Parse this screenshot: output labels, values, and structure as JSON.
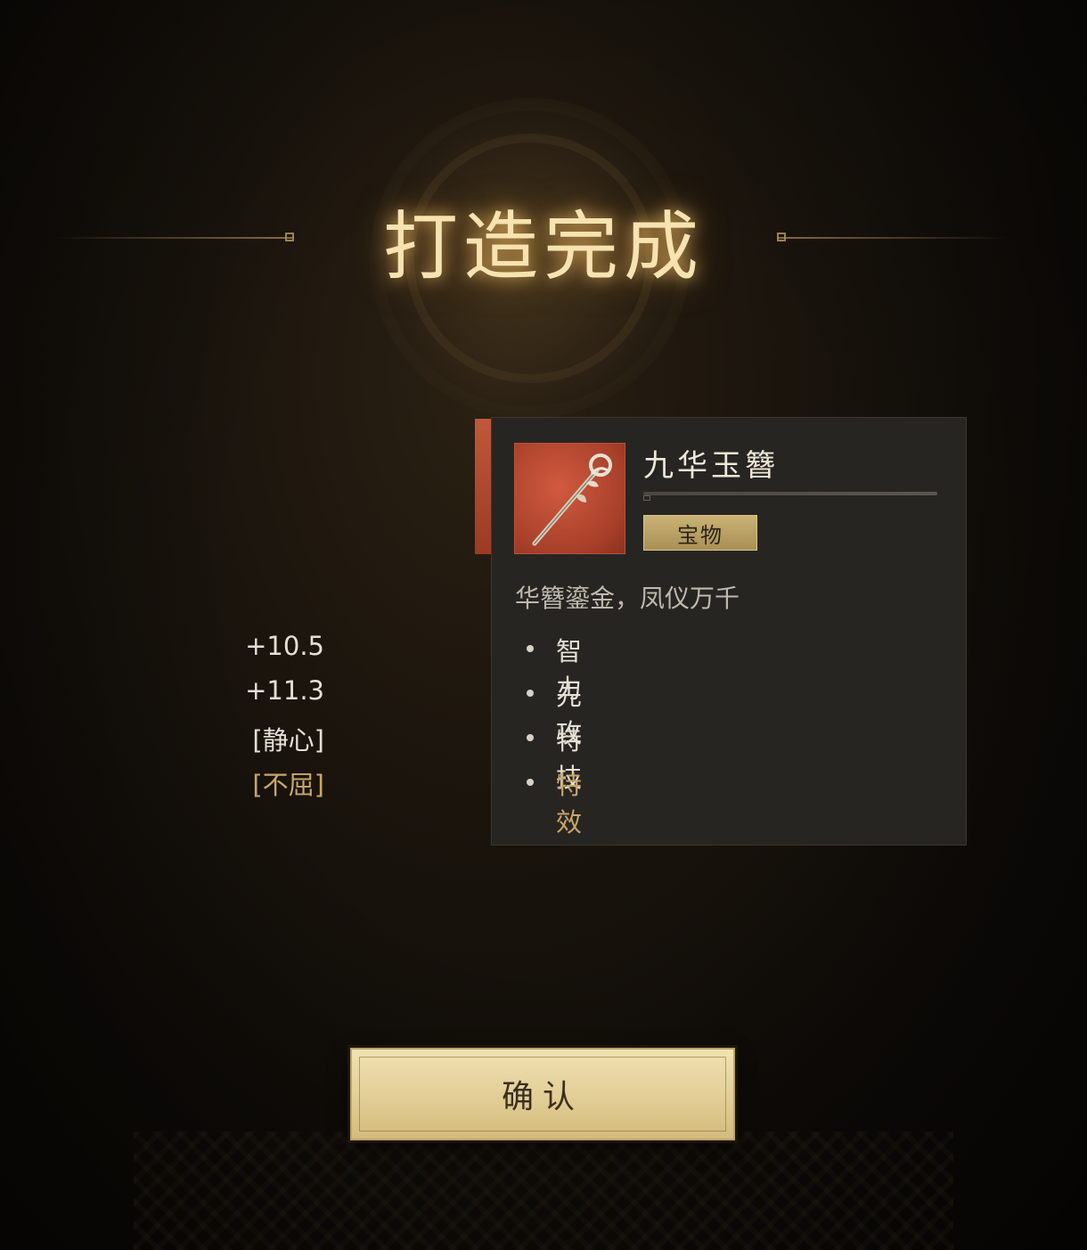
{
  "title": "打造完成",
  "item": {
    "name": "九华玉簪",
    "rarity": "宝物",
    "description": "华簪鎏金，凤仪万千",
    "icon": "hairpin-icon",
    "icon_bg_color": "#b8462f"
  },
  "stats": [
    {
      "label": "智力",
      "value": "+10.5",
      "color": "#e6e0d4"
    },
    {
      "label": "先攻",
      "value": "+11.3",
      "color": "#e6e0d4"
    },
    {
      "label": "特技",
      "value": "[静心]",
      "color": "#e6e0d4"
    },
    {
      "label": "特效",
      "value": "[不屈]",
      "color": "#c9a66a"
    }
  ],
  "confirm_label": "确认",
  "colors": {
    "title_glow": "#f6e3b0",
    "card_bg": "#272522",
    "accent_red": "#c0583a",
    "gold": "#c9a66a",
    "button": "#e3cf98"
  }
}
